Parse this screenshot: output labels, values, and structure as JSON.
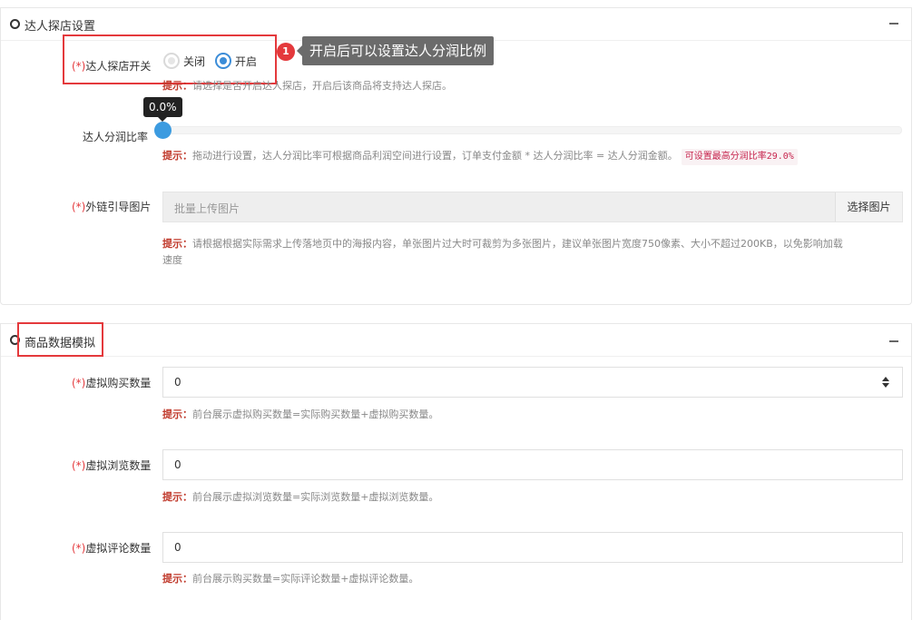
{
  "section1": {
    "title": "达人探店设置",
    "switch": {
      "req": "(*)",
      "label": "达人探店开关",
      "off_label": "关闭",
      "on_label": "开启",
      "selected": "开启",
      "hint_prefix": "提示：",
      "hint_text": "请选择是否开启达人探店，开启后该商品将支持达人探店。"
    },
    "annotation": {
      "number": "1",
      "text": "开启后可以设置达人分润比例"
    },
    "ratio": {
      "label": "达人分润比率",
      "value": "0.0%",
      "value_fraction": 0.0,
      "hint_prefix": "提示：",
      "hint_text": "拖动进行设置，达人分润比率可根据商品利润空间进行设置，订单支付金额 * 达人分润比率 = 达人分润金额。",
      "max_tag": "可设置最高分润比率29.0%"
    },
    "image": {
      "req": "(*)",
      "label": "外链引导图片",
      "placeholder": "批量上传图片",
      "button": "选择图片",
      "hint_prefix": "提示：",
      "hint_line1": "请根据根据实际需求上传落地页中的海报内容，单张图片过大时可裁剪为多张图片，建议单张图片宽度750像素、大小不超过200KB，以免影响加载",
      "hint_line2": "速度"
    }
  },
  "section2": {
    "title": "商品数据模拟",
    "fields": [
      {
        "req": "(*)",
        "label": "虚拟购买数量",
        "value": "0",
        "hint_prefix": "提示：",
        "hint": "前台展示虚拟购买数量=实际购买数量+虚拟购买数量。"
      },
      {
        "req": "(*)",
        "label": "虚拟浏览数量",
        "value": "0",
        "hint_prefix": "提示：",
        "hint": "前台展示虚拟浏览数量=实际浏览数量+虚拟浏览数量。"
      },
      {
        "req": "(*)",
        "label": "虚拟评论数量",
        "value": "0",
        "hint_prefix": "提示：",
        "hint": "前台展示购买数量=实际评论数量+虚拟评论数量。"
      }
    ]
  },
  "colors": {
    "accent": "#3c8dd8",
    "required": "#e4393c",
    "hint_prefix": "#c0392b"
  }
}
